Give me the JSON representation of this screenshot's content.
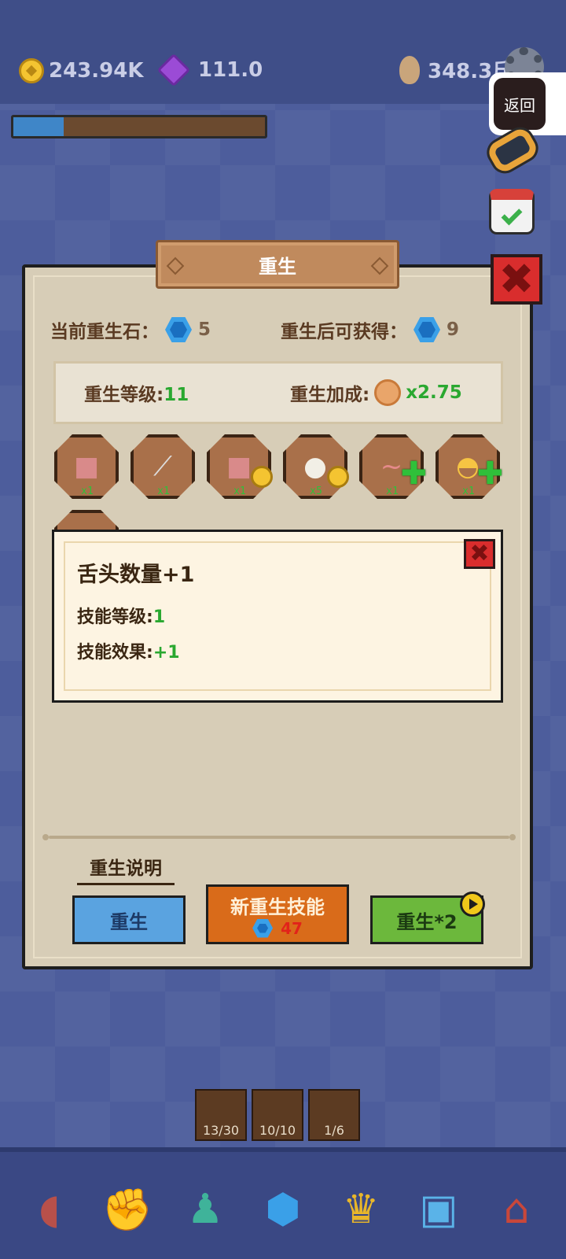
{
  "top": {
    "gold": "243.94K",
    "gems": "111.0",
    "meat": "348.3斤",
    "progress": 0.2
  },
  "return_label": "返回",
  "panel": {
    "title": "重生",
    "current_stone_label": "当前重生石：",
    "current_stone_value": "5",
    "after_label": "重生后可获得：",
    "after_value": "9",
    "level_label": "重生等级:",
    "level_value": "11",
    "bonus_label": "重生加成:",
    "bonus_value": "x2.75",
    "skills": [
      {
        "icon": "meat-cubes-icon",
        "count": "x1"
      },
      {
        "icon": "spatula-icon",
        "count": "x1"
      },
      {
        "icon": "meat-cubes-coin-icon",
        "count": "x1"
      },
      {
        "icon": "bun-coin-icon",
        "count": "x5"
      },
      {
        "icon": "tongue-plus-icon",
        "count": "x1"
      },
      {
        "icon": "egg-bowl-plus-icon",
        "count": "x1"
      }
    ],
    "explain_label": "重生说明",
    "btn_rebirth": "重生",
    "btn_new_skill": "新重生技能",
    "btn_new_skill_cost": "47",
    "btn_rebirth_x2": "重生*2"
  },
  "tooltip": {
    "title": "舌头数量+1",
    "level_label": "技能等级:",
    "level_value": "1",
    "effect_label": "技能效果:",
    "effect_value": "+1"
  },
  "inventory": [
    {
      "icon": "meat-cubes-icon",
      "value": "13/30"
    },
    {
      "icon": "bun-icon",
      "value": "10/10"
    },
    {
      "icon": "tongue-icon",
      "value": "1/6"
    }
  ],
  "nav": [
    {
      "icon": "ham-icon"
    },
    {
      "icon": "fist-icon"
    },
    {
      "icon": "character-icon"
    },
    {
      "icon": "blue-gem-icon"
    },
    {
      "icon": "trophy-icon"
    },
    {
      "icon": "clipboard-icon"
    },
    {
      "icon": "shop-icon"
    }
  ]
}
